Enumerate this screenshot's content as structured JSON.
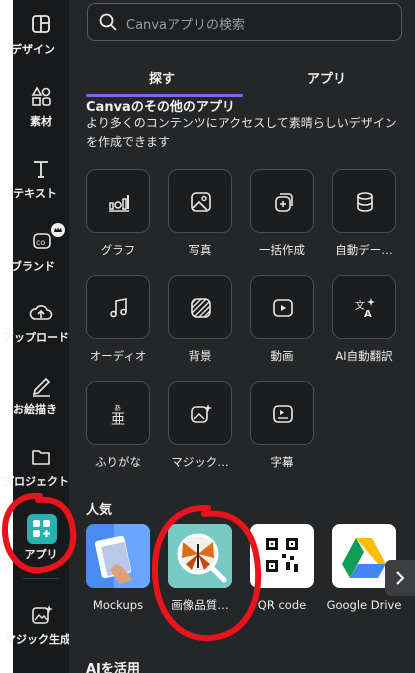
{
  "rail": {
    "items": [
      {
        "label": "デザイン",
        "icon": "layout-icon"
      },
      {
        "label": "素材",
        "icon": "shapes-icon"
      },
      {
        "label": "テキスト",
        "icon": "text-icon"
      },
      {
        "label": "ブランド",
        "icon": "brand-crown-icon"
      },
      {
        "label": "アップロード",
        "icon": "cloud-upload-icon"
      },
      {
        "label": "お絵描き",
        "icon": "pen-icon"
      },
      {
        "label": "プロジェクト",
        "icon": "folder-icon"
      },
      {
        "label": "アプリ",
        "icon": "apps-icon"
      },
      {
        "label": "マジック生成",
        "icon": "magic-image-icon"
      }
    ]
  },
  "search": {
    "placeholder": "Canvaアプリの検索"
  },
  "tabs": [
    {
      "label": "探す"
    },
    {
      "label": "アプリ"
    }
  ],
  "other_apps": {
    "title": "Canvaのその他のアプリ",
    "description": "より多くのコンテンツにアクセスして素晴らしいデザインを作成できます",
    "tiles": [
      {
        "label": "グラフ",
        "icon": "chart-icon"
      },
      {
        "label": "写真",
        "icon": "photo-icon"
      },
      {
        "label": "一括作成",
        "icon": "bulk-create-icon"
      },
      {
        "label": "自動デー…",
        "icon": "database-icon"
      },
      {
        "label": "オーディオ",
        "icon": "music-icon"
      },
      {
        "label": "背景",
        "icon": "pattern-icon"
      },
      {
        "label": "動画",
        "icon": "video-icon"
      },
      {
        "label": "AI自動翻訳",
        "icon": "translate-icon"
      },
      {
        "label": "ふりがな",
        "icon": "furigana-icon"
      },
      {
        "label": "マジック…",
        "icon": "magic-edit-icon"
      },
      {
        "label": "字幕",
        "icon": "caption-icon"
      }
    ]
  },
  "popular": {
    "title": "人気",
    "items": [
      {
        "label": "Mockups"
      },
      {
        "label": "画像品質…"
      },
      {
        "label": "QR code"
      },
      {
        "label": "Google Drive"
      }
    ]
  },
  "ai": {
    "title": "AIを活用"
  },
  "colors": {
    "accent": "#8b5cf6",
    "highlight_circle": "#e8131b",
    "apps_tile": "#27b3ad"
  }
}
